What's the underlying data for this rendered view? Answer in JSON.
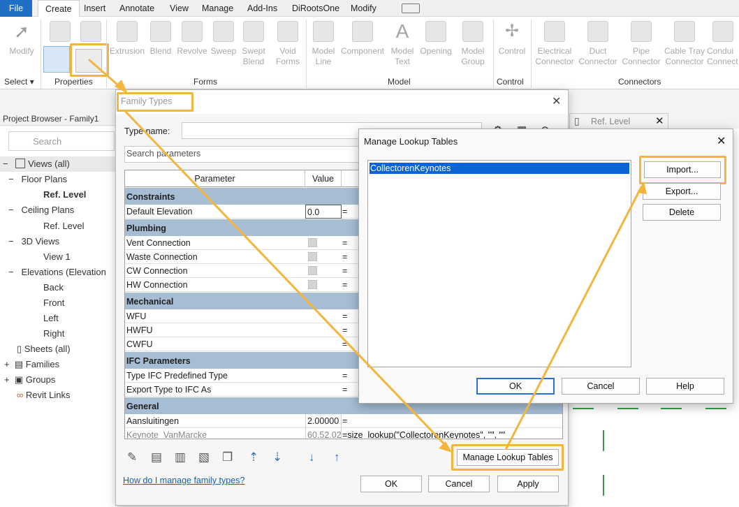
{
  "menu": {
    "file": "File",
    "create": "Create",
    "insert": "Insert",
    "annotate": "Annotate",
    "view": "View",
    "manage": "Manage",
    "addins": "Add-Ins",
    "diroots": "DiRootsOne",
    "modify": "Modify"
  },
  "ribbon": {
    "modify": "Modify",
    "extrusion": "Extrusion",
    "blend": "Blend",
    "revolve": "Revolve",
    "sweep": "Sweep",
    "swept_blend_1": "Swept",
    "swept_blend_2": "Blend",
    "void_forms_1": "Void",
    "void_forms_2": "Forms",
    "model_line_1": "Model",
    "model_line_2": "Line",
    "component": "Component",
    "model_text_1": "Model",
    "model_text_2": "Text",
    "opening": "Opening",
    "model_group_1": "Model",
    "model_group_2": "Group",
    "control": "Control",
    "electrical_1": "Electrical",
    "electrical_2": "Connector",
    "duct_1": "Duct",
    "duct_2": "Connector",
    "pipe_1": "Pipe",
    "pipe_2": "Connector",
    "cabletray_1": "Cable Tray",
    "cabletray_2": "Connector",
    "conduit_1": "Condui",
    "conduit_2": "Connect",
    "panels": {
      "select": "Select",
      "properties": "Properties",
      "forms": "Forms",
      "model": "Model",
      "control": "Control",
      "connectors": "Connectors"
    }
  },
  "project_browser": {
    "title": "Project Browser - Family1",
    "search_placeholder": "Search",
    "items": {
      "views": "Views (all)",
      "floor_plans": "Floor Plans",
      "ref_level": "Ref. Level",
      "ceiling_plans": "Ceiling Plans",
      "ceiling_ref": "Ref. Level",
      "views3d": "3D Views",
      "view1": "View 1",
      "elevations": "Elevations (Elevation",
      "back": "Back",
      "front": "Front",
      "left": "Left",
      "right": "Right",
      "sheets": "Sheets (all)",
      "families": "Families",
      "groups": "Groups",
      "revit_links": "Revit Links"
    }
  },
  "view_tab": {
    "title": "Ref. Level"
  },
  "family_types": {
    "title": "Family Types",
    "type_name_label": "Type name:",
    "search_placeholder": "Search parameters",
    "col_parameter": "Parameter",
    "col_value": "Value",
    "groups": {
      "constraints": "Constraints",
      "plumbing": "Plumbing",
      "mechanical": "Mechanical",
      "ifc": "IFC Parameters",
      "general": "General"
    },
    "rows": {
      "default_elevation": "Default Elevation",
      "default_elevation_val": "0.0",
      "vent": "Vent Connection",
      "waste": "Waste Connection",
      "cw": "CW Connection",
      "hw": "HW Connection",
      "wfu": "WFU",
      "hwfu": "HWFU",
      "cwfu": "CWFU",
      "ifc_type": "Type IFC Predefined Type",
      "export_type": "Export Type to IFC As",
      "aansluitingen": "Aansluitingen",
      "aansluitingen_val": "2.00000",
      "keynote": "Keynote_VanMarcke",
      "keynote_val": "60.52.02",
      "keynote_formula": "size_lookup(\"CollectorenKeynotes\", \"\", \"\""
    },
    "eq": "=",
    "manage_lookup": "Manage Lookup Tables",
    "help_link": "How do I manage family types?",
    "ok": "OK",
    "cancel": "Cancel",
    "apply": "Apply"
  },
  "lookup": {
    "title": "Manage Lookup Tables",
    "item": "CollectorenKeynotes",
    "import": "Import...",
    "export": "Export...",
    "delete": "Delete",
    "ok": "OK",
    "cancel": "Cancel",
    "help": "Help"
  },
  "colors": {
    "highlight": "#f3b53d",
    "selection": "#0a64d6",
    "group_header": "#a7bdd4",
    "file_tab": "#1f6fc5"
  }
}
